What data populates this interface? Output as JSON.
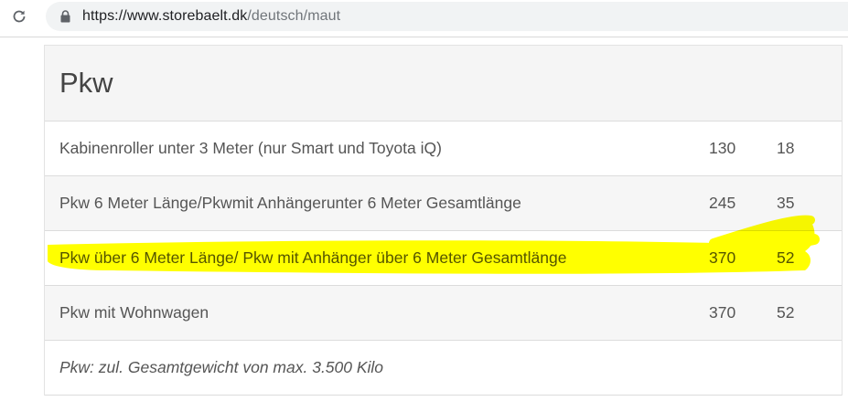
{
  "browser": {
    "url_host": "https://www.storebaelt.dk",
    "url_path": "/deutsch/maut"
  },
  "table": {
    "heading": "Pkw",
    "rows": [
      {
        "label": "Kabinenroller unter 3 Meter (nur Smart und Toyota iQ)",
        "value1": "130",
        "value2": "18"
      },
      {
        "label": "Pkw 6 Meter Länge/Pkwmit Anhängerunter 6 Meter Gesamtlänge",
        "value1": "245",
        "value2": "35"
      },
      {
        "label": "Pkw über 6 Meter Länge/ Pkw mit Anhänger über 6 Meter Gesamtlänge",
        "value1": "370",
        "value2": "52"
      },
      {
        "label": "Pkw mit Wohnwagen",
        "value1": "370",
        "value2": "52"
      }
    ],
    "note": "Pkw: zul. Gesamtgewicht von max. 3.500 Kilo"
  },
  "colors": {
    "highlight": "#ffff00",
    "url_host": "#202124",
    "url_path": "#70757a"
  },
  "icons": [
    "reload-icon",
    "lock-icon"
  ]
}
